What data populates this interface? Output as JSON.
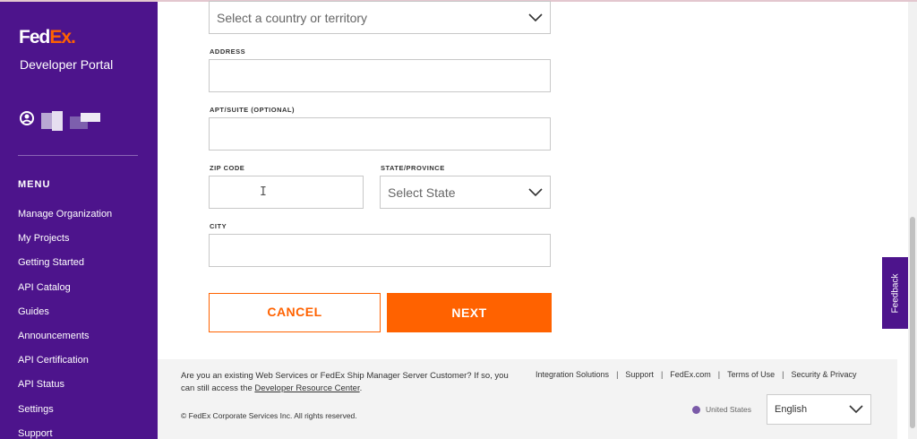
{
  "brand": {
    "logo_fed": "Fed",
    "logo_ex": "Ex",
    "logo_dot": ".",
    "portal_name": "Developer Portal",
    "accent_purple": "#4d148c",
    "accent_orange": "#ff6200"
  },
  "sidebar": {
    "menu_title": "MENU",
    "items": [
      {
        "label": "Manage Organization"
      },
      {
        "label": "My Projects"
      },
      {
        "label": "Getting Started"
      },
      {
        "label": "API Catalog"
      },
      {
        "label": "Guides"
      },
      {
        "label": "Announcements"
      },
      {
        "label": "API Certification"
      },
      {
        "label": "API Status"
      },
      {
        "label": "Settings"
      },
      {
        "label": "Support"
      }
    ]
  },
  "form": {
    "country": {
      "placeholder": "Select a country or territory"
    },
    "address": {
      "label": "ADDRESS",
      "value": ""
    },
    "apt": {
      "label": "APT/SUITE (OPTIONAL)",
      "value": ""
    },
    "zip": {
      "label": "ZIP CODE",
      "value": ""
    },
    "state": {
      "label": "STATE/PROVINCE",
      "placeholder": "Select State"
    },
    "city": {
      "label": "CITY",
      "value": ""
    },
    "cancel_label": "CANCEL",
    "next_label": "NEXT"
  },
  "feedback": {
    "label": "Feedback"
  },
  "footer": {
    "customer_text": "Are you an existing Web Services or FedEx Ship Manager Server Customer? If so, you can still access the",
    "customer_link": "Developer Resource Center",
    "customer_end": ".",
    "links": [
      {
        "label": "Integration Solutions"
      },
      {
        "label": "Support"
      },
      {
        "label": "FedEx.com"
      },
      {
        "label": "Terms of Use"
      },
      {
        "label": "Security & Privacy"
      }
    ],
    "separator": "|",
    "copyright": "© FedEx Corporate Services Inc. All rights reserved.",
    "region": "United States",
    "language": "English"
  },
  "icons": {
    "user": "user-circle-icon",
    "chevron": "chevron-down-icon",
    "text_cursor": "text-cursor-icon",
    "globe": "globe-icon"
  }
}
